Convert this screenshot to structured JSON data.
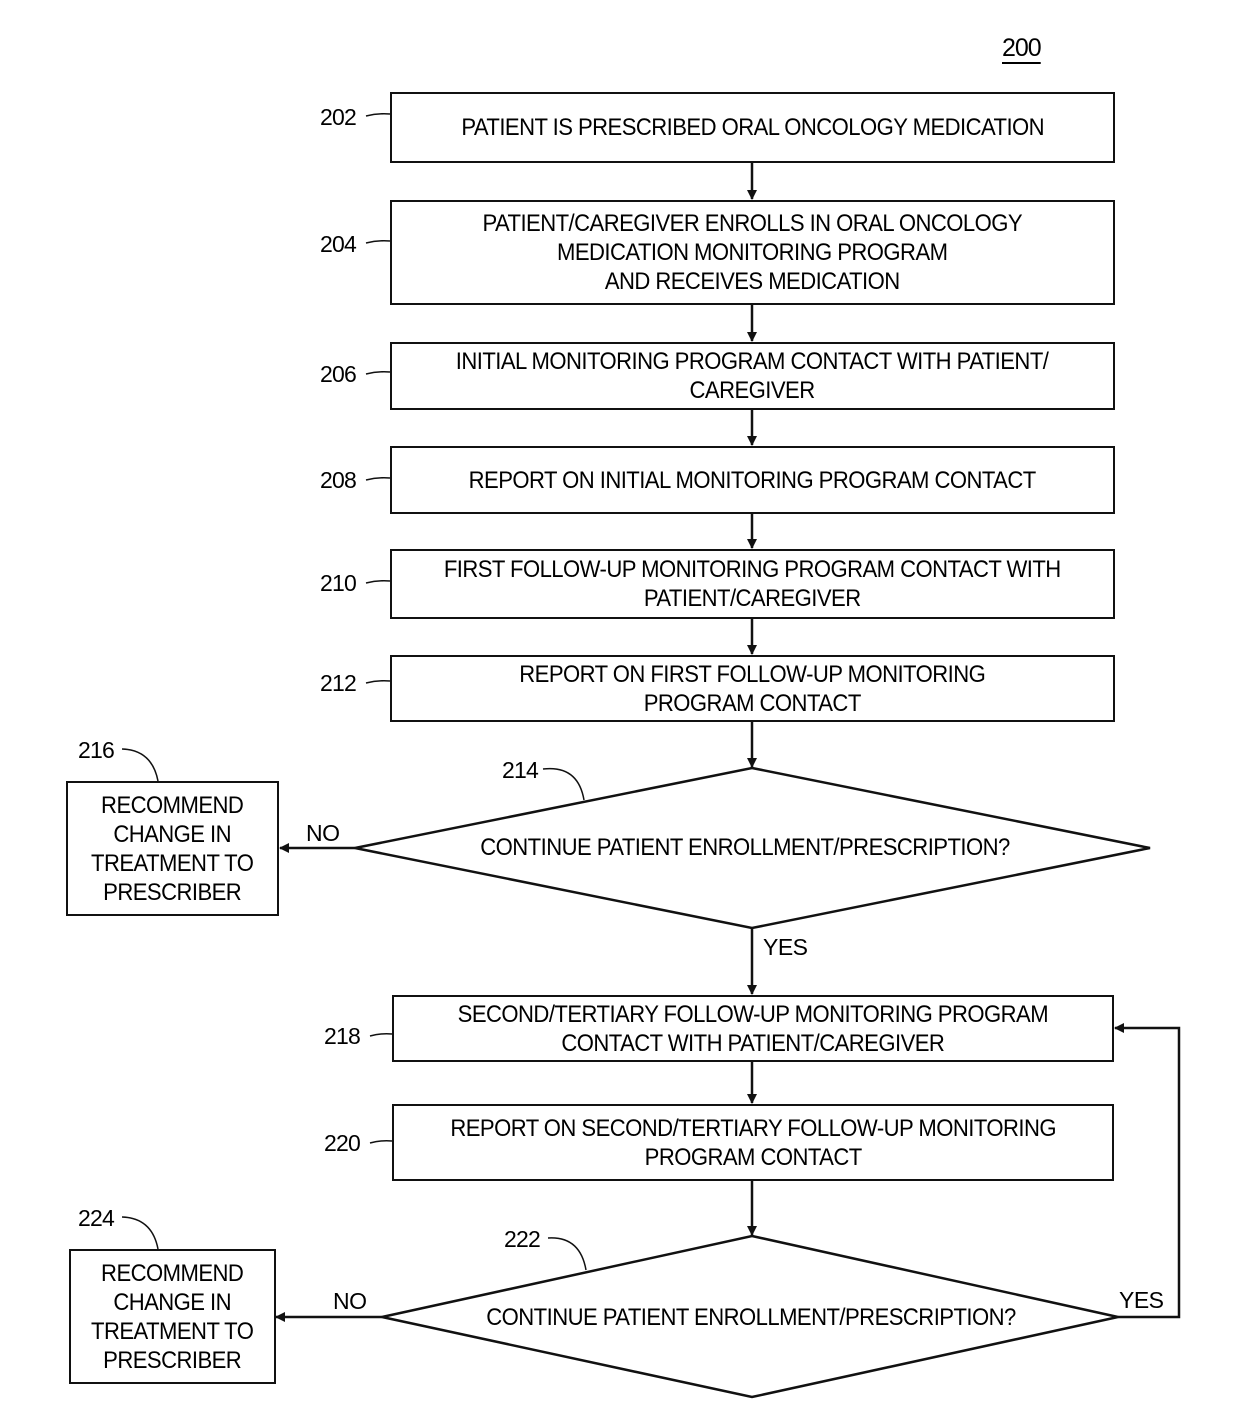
{
  "figure_number": "200",
  "steps": [
    {
      "ref": "202",
      "text": "PATIENT IS PRESCRIBED ORAL ONCOLOGY MEDICATION"
    },
    {
      "ref": "204",
      "text": "PATIENT/CAREGIVER ENROLLS IN ORAL ONCOLOGY\nMEDICATION MONITORING PROGRAM\nAND RECEIVES MEDICATION"
    },
    {
      "ref": "206",
      "text": "INITIAL MONITORING PROGRAM CONTACT WITH PATIENT/\nCAREGIVER"
    },
    {
      "ref": "208",
      "text": "REPORT ON INITIAL MONITORING PROGRAM CONTACT"
    },
    {
      "ref": "210",
      "text": "FIRST FOLLOW-UP MONITORING PROGRAM CONTACT WITH\nPATIENT/CAREGIVER"
    },
    {
      "ref": "212",
      "text": "REPORT ON FIRST FOLLOW-UP MONITORING\nPROGRAM CONTACT"
    },
    {
      "ref": "218",
      "text": "SECOND/TERTIARY FOLLOW-UP MONITORING PROGRAM\nCONTACT WITH PATIENT/CAREGIVER"
    },
    {
      "ref": "220",
      "text": "REPORT ON SECOND/TERTIARY FOLLOW-UP MONITORING\nPROGRAM CONTACT"
    }
  ],
  "decisions": [
    {
      "ref": "214",
      "text": "CONTINUE PATIENT ENROLLMENT/PRESCRIPTION?",
      "no_label": "NO",
      "yes_label": "YES"
    },
    {
      "ref": "222",
      "text": "CONTINUE PATIENT ENROLLMENT/PRESCRIPTION?",
      "no_label": "NO",
      "yes_label": "YES"
    }
  ],
  "outcomes": [
    {
      "ref": "216",
      "text": "RECOMMEND\nCHANGE IN\nTREATMENT TO\nPRESCRIBER"
    },
    {
      "ref": "224",
      "text": "RECOMMEND\nCHANGE IN\nTREATMENT TO\nPRESCRIBER"
    }
  ]
}
